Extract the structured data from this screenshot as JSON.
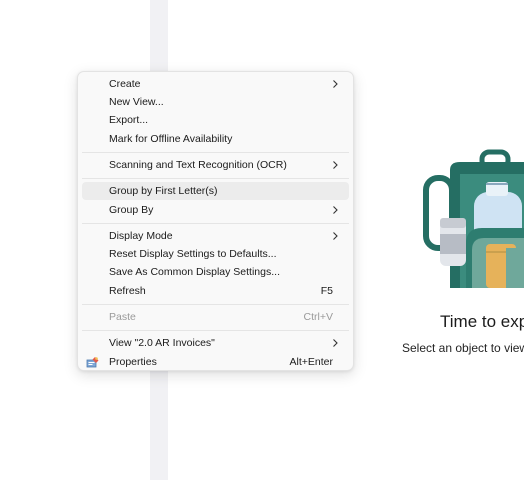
{
  "empty_state": {
    "title": "Time to exp",
    "subtitle": "Select an object to view"
  },
  "context_menu": {
    "items": [
      {
        "label": "Create",
        "submenu": true
      },
      {
        "label": "New View..."
      },
      {
        "label": "Export..."
      },
      {
        "label": "Mark for Offline Availability"
      },
      {
        "label": "Scanning and Text Recognition (OCR)",
        "submenu": true
      },
      {
        "label": "Group by First Letter(s)",
        "hovered": true
      },
      {
        "label": "Group By",
        "submenu": true
      },
      {
        "label": "Display Mode",
        "submenu": true
      },
      {
        "label": "Reset Display Settings to Defaults..."
      },
      {
        "label": "Save As Common Display Settings..."
      },
      {
        "label": "Refresh",
        "shortcut": "F5"
      },
      {
        "label": "Paste",
        "shortcut": "Ctrl+V",
        "disabled": true
      },
      {
        "label": "View \"2.0 AR Invoices\"",
        "submenu": true
      },
      {
        "label": "Properties",
        "shortcut": "Alt+Enter",
        "icon": "properties-icon"
      }
    ]
  },
  "colors": {
    "teal_dark": "#256e63",
    "teal_mid": "#3b8c7e",
    "teal_light": "#6fa89b",
    "bottle_blue": "#cfe3f3",
    "amber": "#e6b25a"
  }
}
